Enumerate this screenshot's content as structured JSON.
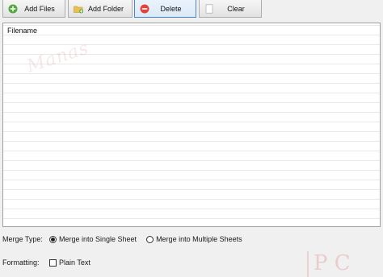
{
  "toolbar": {
    "add_files": "Add Files",
    "add_folder": "Add Folder",
    "delete": "Delete",
    "clear": "Clear"
  },
  "file_list": {
    "column_header": "Filename",
    "rows": []
  },
  "merge_type": {
    "label": "Merge Type:",
    "options": [
      "Merge into Single Sheet",
      "Merge into Multiple Sheets"
    ],
    "selected": "Merge into Single Sheet"
  },
  "formatting": {
    "label": "Formatting:",
    "plain_text_label": "Plain Text",
    "plain_text_checked": false
  },
  "icons": {
    "add_files": "plus-circle-icon",
    "add_folder": "folder-plus-icon",
    "delete": "minus-circle-icon",
    "clear": "blank-page-icon"
  },
  "colors": {
    "add_green": "#55a83a",
    "delete_red": "#e0443c",
    "folder_yellow": "#e8c24a",
    "active_border": "#4a86c9"
  }
}
